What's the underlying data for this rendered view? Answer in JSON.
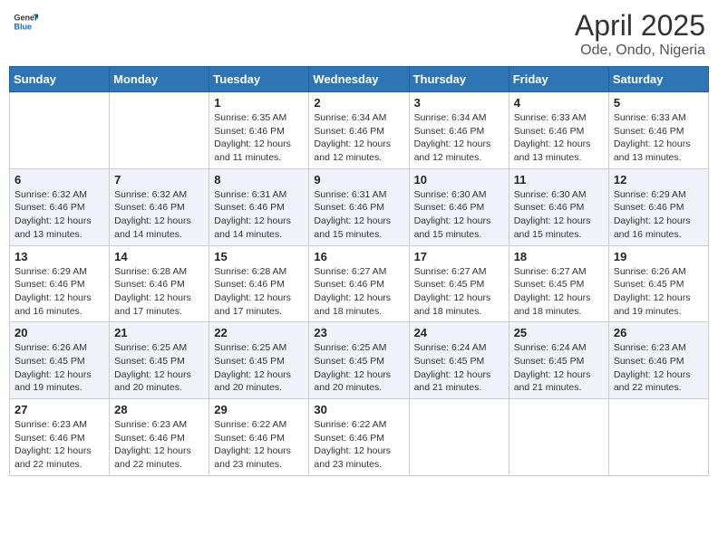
{
  "header": {
    "logo_general": "General",
    "logo_blue": "Blue",
    "month": "April 2025",
    "location": "Ode, Ondo, Nigeria"
  },
  "weekdays": [
    "Sunday",
    "Monday",
    "Tuesday",
    "Wednesday",
    "Thursday",
    "Friday",
    "Saturday"
  ],
  "weeks": [
    [
      {
        "day": "",
        "info": ""
      },
      {
        "day": "",
        "info": ""
      },
      {
        "day": "1",
        "info": "Sunrise: 6:35 AM\nSunset: 6:46 PM\nDaylight: 12 hours and 11 minutes."
      },
      {
        "day": "2",
        "info": "Sunrise: 6:34 AM\nSunset: 6:46 PM\nDaylight: 12 hours and 12 minutes."
      },
      {
        "day": "3",
        "info": "Sunrise: 6:34 AM\nSunset: 6:46 PM\nDaylight: 12 hours and 12 minutes."
      },
      {
        "day": "4",
        "info": "Sunrise: 6:33 AM\nSunset: 6:46 PM\nDaylight: 12 hours and 13 minutes."
      },
      {
        "day": "5",
        "info": "Sunrise: 6:33 AM\nSunset: 6:46 PM\nDaylight: 12 hours and 13 minutes."
      }
    ],
    [
      {
        "day": "6",
        "info": "Sunrise: 6:32 AM\nSunset: 6:46 PM\nDaylight: 12 hours and 13 minutes."
      },
      {
        "day": "7",
        "info": "Sunrise: 6:32 AM\nSunset: 6:46 PM\nDaylight: 12 hours and 14 minutes."
      },
      {
        "day": "8",
        "info": "Sunrise: 6:31 AM\nSunset: 6:46 PM\nDaylight: 12 hours and 14 minutes."
      },
      {
        "day": "9",
        "info": "Sunrise: 6:31 AM\nSunset: 6:46 PM\nDaylight: 12 hours and 15 minutes."
      },
      {
        "day": "10",
        "info": "Sunrise: 6:30 AM\nSunset: 6:46 PM\nDaylight: 12 hours and 15 minutes."
      },
      {
        "day": "11",
        "info": "Sunrise: 6:30 AM\nSunset: 6:46 PM\nDaylight: 12 hours and 15 minutes."
      },
      {
        "day": "12",
        "info": "Sunrise: 6:29 AM\nSunset: 6:46 PM\nDaylight: 12 hours and 16 minutes."
      }
    ],
    [
      {
        "day": "13",
        "info": "Sunrise: 6:29 AM\nSunset: 6:46 PM\nDaylight: 12 hours and 16 minutes."
      },
      {
        "day": "14",
        "info": "Sunrise: 6:28 AM\nSunset: 6:46 PM\nDaylight: 12 hours and 17 minutes."
      },
      {
        "day": "15",
        "info": "Sunrise: 6:28 AM\nSunset: 6:46 PM\nDaylight: 12 hours and 17 minutes."
      },
      {
        "day": "16",
        "info": "Sunrise: 6:27 AM\nSunset: 6:46 PM\nDaylight: 12 hours and 18 minutes."
      },
      {
        "day": "17",
        "info": "Sunrise: 6:27 AM\nSunset: 6:45 PM\nDaylight: 12 hours and 18 minutes."
      },
      {
        "day": "18",
        "info": "Sunrise: 6:27 AM\nSunset: 6:45 PM\nDaylight: 12 hours and 18 minutes."
      },
      {
        "day": "19",
        "info": "Sunrise: 6:26 AM\nSunset: 6:45 PM\nDaylight: 12 hours and 19 minutes."
      }
    ],
    [
      {
        "day": "20",
        "info": "Sunrise: 6:26 AM\nSunset: 6:45 PM\nDaylight: 12 hours and 19 minutes."
      },
      {
        "day": "21",
        "info": "Sunrise: 6:25 AM\nSunset: 6:45 PM\nDaylight: 12 hours and 20 minutes."
      },
      {
        "day": "22",
        "info": "Sunrise: 6:25 AM\nSunset: 6:45 PM\nDaylight: 12 hours and 20 minutes."
      },
      {
        "day": "23",
        "info": "Sunrise: 6:25 AM\nSunset: 6:45 PM\nDaylight: 12 hours and 20 minutes."
      },
      {
        "day": "24",
        "info": "Sunrise: 6:24 AM\nSunset: 6:45 PM\nDaylight: 12 hours and 21 minutes."
      },
      {
        "day": "25",
        "info": "Sunrise: 6:24 AM\nSunset: 6:45 PM\nDaylight: 12 hours and 21 minutes."
      },
      {
        "day": "26",
        "info": "Sunrise: 6:23 AM\nSunset: 6:46 PM\nDaylight: 12 hours and 22 minutes."
      }
    ],
    [
      {
        "day": "27",
        "info": "Sunrise: 6:23 AM\nSunset: 6:46 PM\nDaylight: 12 hours and 22 minutes."
      },
      {
        "day": "28",
        "info": "Sunrise: 6:23 AM\nSunset: 6:46 PM\nDaylight: 12 hours and 22 minutes."
      },
      {
        "day": "29",
        "info": "Sunrise: 6:22 AM\nSunset: 6:46 PM\nDaylight: 12 hours and 23 minutes."
      },
      {
        "day": "30",
        "info": "Sunrise: 6:22 AM\nSunset: 6:46 PM\nDaylight: 12 hours and 23 minutes."
      },
      {
        "day": "",
        "info": ""
      },
      {
        "day": "",
        "info": ""
      },
      {
        "day": "",
        "info": ""
      }
    ]
  ]
}
